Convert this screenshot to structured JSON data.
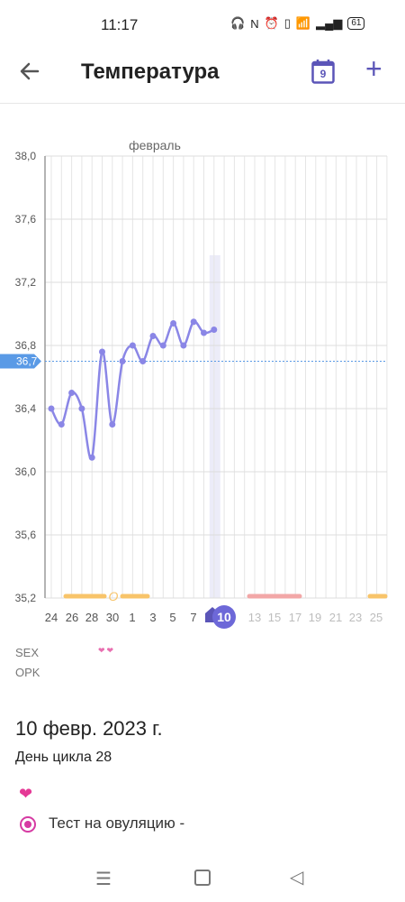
{
  "status": {
    "time": "11:17",
    "battery": "61"
  },
  "header": {
    "title": "Температура",
    "calendar_day": "9"
  },
  "chart_data": {
    "type": "line",
    "title": "февраль",
    "ylim": [
      35.2,
      38.0
    ],
    "y_ticks": [
      "35,2",
      "35,6",
      "36,0",
      "36,4",
      "36,8",
      "37,2",
      "37,6",
      "38,0"
    ],
    "x_tick_labels": [
      "24",
      "26",
      "28",
      "30",
      "1",
      "3",
      "5",
      "7",
      "10",
      "13",
      "15",
      "17",
      "19",
      "21",
      "23",
      "25"
    ],
    "selected_day": "10",
    "cover_line": 36.7,
    "cover_line_label": "36,7",
    "series": [
      {
        "values": [
          36.4,
          36.3,
          36.5,
          36.4,
          36.09,
          36.76,
          36.3,
          36.7,
          36.8,
          36.7,
          36.86,
          36.8,
          36.94,
          36.8,
          36.95,
          36.88,
          36.9
        ]
      }
    ],
    "ovulation_marker": "O",
    "grid": true
  },
  "labels": {
    "sex": "SEX",
    "opk": "OPK"
  },
  "day_info": {
    "date": "10 февр. 2023 г.",
    "cycle_day": "День цикла 28"
  },
  "events": {
    "ovulation_test": "Тест на овуляцию -"
  },
  "colors": {
    "accent": "#5b55b8",
    "line": "#8a86e6",
    "cover": "#5a9ae6",
    "fertile": "#f8c46a",
    "period": "#f2a7a7",
    "heart": "#e53996"
  }
}
